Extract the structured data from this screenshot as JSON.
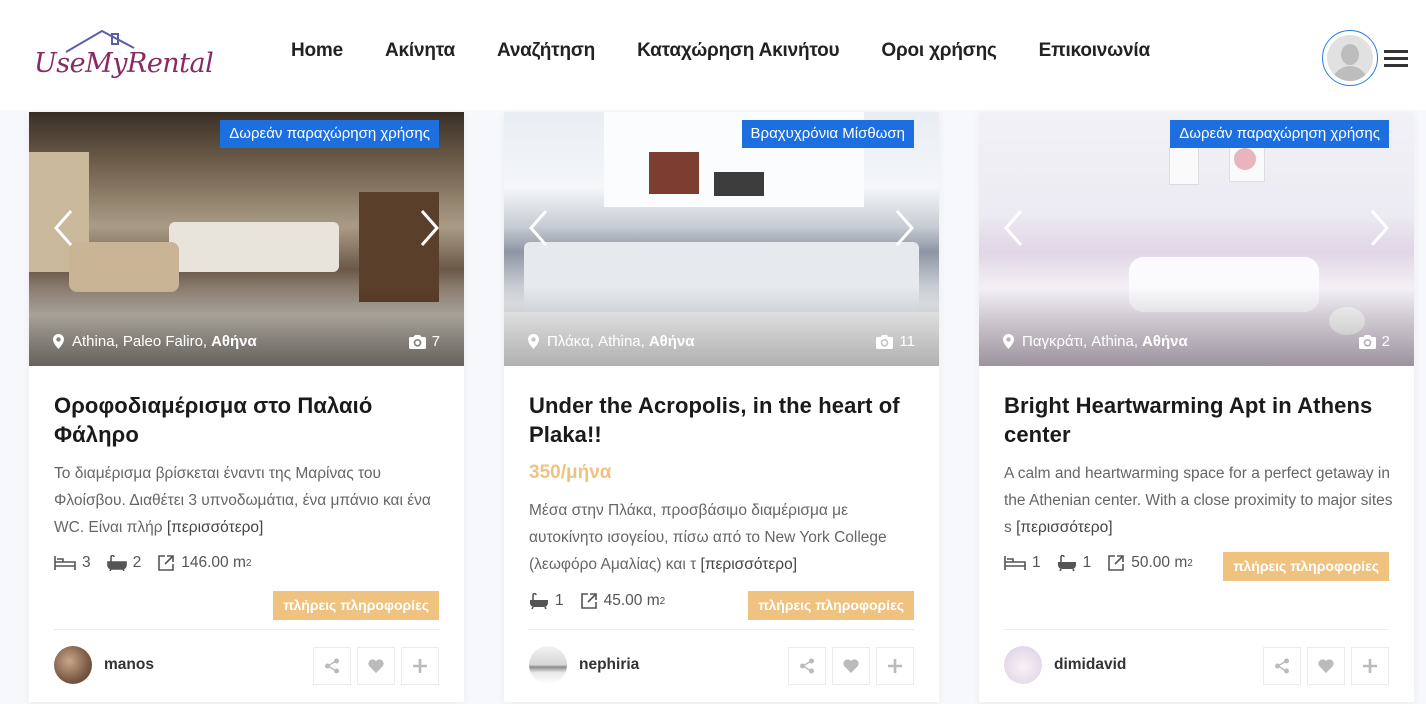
{
  "brand": {
    "logo_text": "UseMyRental"
  },
  "nav": [
    "Home",
    "Ακίνητα",
    "Αναζήτηση",
    "Καταχώρηση Ακινήτου",
    "Οροι χρήσης",
    "Επικοινωνία"
  ],
  "listings": [
    {
      "badge": "Δωρεάν παραχώρηση χρήσης",
      "location_area": "Athina, Paleo Faliro,",
      "location_city": "Αθήνα",
      "photo_count": "7",
      "title": "Οροφοδιαμέρισμα στο Παλαιό Φάληρο",
      "price": "",
      "description": "Το διαμέρισμα βρίσκεται έναντι της Μαρίνας του Φλοίσβου. Διαθέτει 3 υπνοδωμάτια, ένα μπάνιο και ένα WC. Είναι πλήρ",
      "more": "[περισσότερο]",
      "beds": "3",
      "baths": "2",
      "area": "146.00 m",
      "area_unit_sup": "2",
      "info_button": "πλήρεις πληροφορίες",
      "owner": "manos"
    },
    {
      "badge": "Βραχυχρόνια Μίσθωση",
      "location_area": "Πλάκα, Athina,",
      "location_city": "Αθήνα",
      "photo_count": "11",
      "title": "Under the Acropolis, in the heart of Plaka!!",
      "price": "350/μήνα",
      "description": "Μέσα στην Πλάκα, προσβάσιμο διαμέρισμα με αυτοκίνητο ισογείου, πίσω από το New York College (λεωφόρο Αμαλίας) και τ",
      "more": "[περισσότερο]",
      "beds": "",
      "baths": "1",
      "area": "45.00 m",
      "area_unit_sup": "2",
      "info_button": "πλήρεις πληροφορίες",
      "owner": "nephiria"
    },
    {
      "badge": "Δωρεάν παραχώρηση χρήσης",
      "location_area": "Παγκράτι, Athina,",
      "location_city": "Αθήνα",
      "photo_count": "2",
      "title": "Bright Heartwarming Apt in Athens center",
      "price": "",
      "description": "A calm and heartwarming space for a perfect getaway in the Athenian center. With a close proximity to major sites s",
      "more": "[περισσότερο]",
      "beds": "1",
      "baths": "1",
      "area": "50.00 m",
      "area_unit_sup": "2",
      "info_button": "πλήρεις πληροφορίες",
      "owner": "dimidavid"
    }
  ],
  "colors": {
    "accent_blue": "#1d6fe0",
    "accent_gold": "#f0c27f",
    "brand_purple": "#8a2a62"
  }
}
